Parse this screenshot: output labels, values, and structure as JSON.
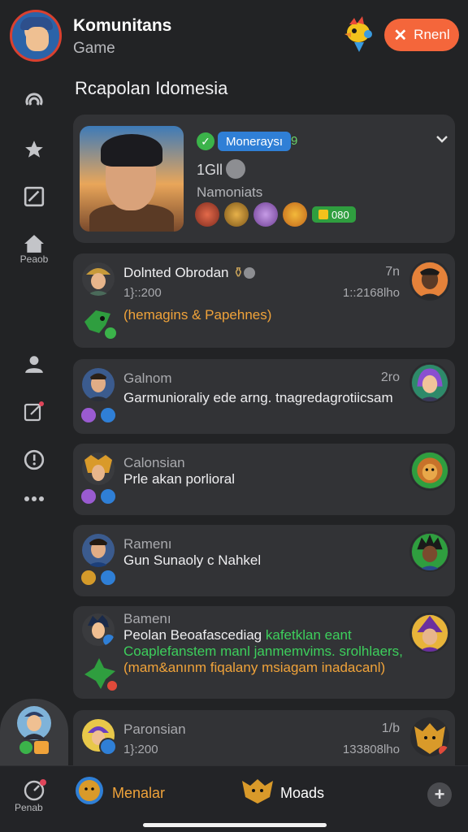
{
  "header": {
    "title": "Komunitans",
    "subtitle": "Game",
    "renew_label": "Rnenl"
  },
  "sidebar": {
    "items": [
      {
        "icon": "swirl-icon"
      },
      {
        "icon": "star-icon"
      },
      {
        "icon": "edit-box-icon"
      },
      {
        "icon": "home-icon",
        "label": "Peaob"
      },
      {
        "icon": "user-icon"
      },
      {
        "icon": "compose-icon"
      },
      {
        "icon": "info-icon"
      },
      {
        "icon": "more-icon"
      }
    ]
  },
  "section_title": "Rcapolan Idomesia",
  "profile": {
    "tag": "Moneraysı",
    "tag_count": "9",
    "level": "1Gll",
    "subtitle": "Namoniats",
    "score": "080"
  },
  "feed": [
    {
      "name": "Dolnted Obrodan",
      "time": "7n",
      "meta_left": "1}::200",
      "meta_right": "1::2168lho",
      "text": "(hemagins & Papehnes)"
    },
    {
      "name": "Galnom",
      "time": "2ro",
      "text": "Garmunioraliy ede arng. tnagredagrotiicsam"
    },
    {
      "name": "Calonsian",
      "text": "Prle akan porlioral"
    },
    {
      "name": "Ramenı",
      "text": "Gun Sunaoly c Nahkel"
    },
    {
      "name": "Bamenı",
      "line1": "Peolan Beoafascediag",
      "line1_extra": "kafetklan eant",
      "line2": "Coaplefanstem manl janmemvims. srolhlaers,",
      "line3": "(mam&anınm fiqalany msiagam inadacanl)"
    },
    {
      "name": "Paronsian",
      "time": "1/b",
      "meta_left": "1}:200",
      "meta_right": "133808lho"
    }
  ],
  "bottom_bar": {
    "left_label": "Penab",
    "tab1_label": "Menalar",
    "tab2_label": "Moads"
  },
  "colors": {
    "accent": "#f4663b",
    "background": "#222325",
    "card": "#323336",
    "tag_blue": "#2f7fd6",
    "success_green": "#3bb34a",
    "highlight_orange": "#f0a33a"
  }
}
